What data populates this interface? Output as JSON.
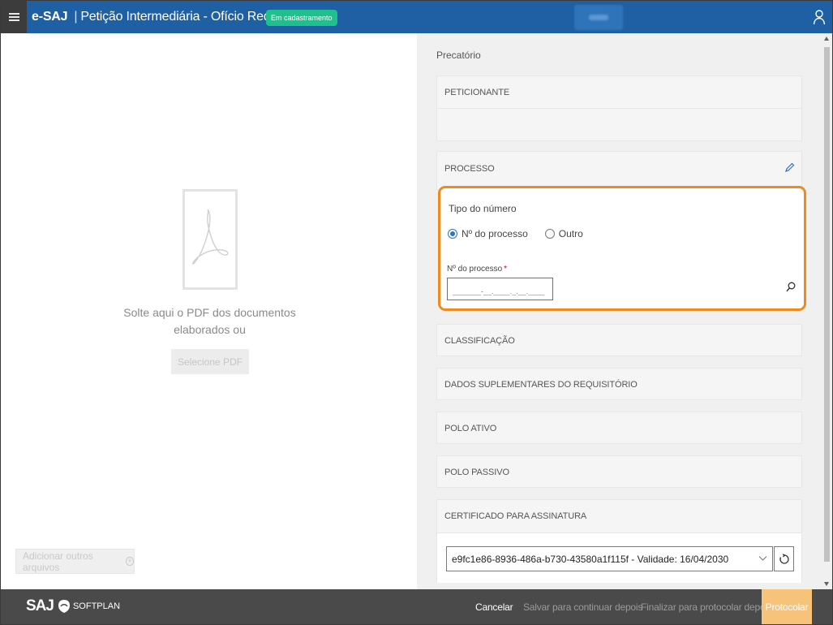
{
  "header": {
    "brand": "e-SAJ",
    "separator": "|",
    "title": "Petição Intermediária - Ofício Requisitório",
    "status_badge": "Em cadastramento"
  },
  "left": {
    "drop_text": "Solte aqui o PDF dos documentos elaborados ou",
    "select_pdf": "Selecione PDF",
    "add_files": "Adicionar outros arquivos",
    "add_files_icon": "plus-circle-icon"
  },
  "right": {
    "section": "Precatório",
    "peticionante": "PETICIONANTE",
    "processo": "PROCESSO",
    "tipo_label": "Tipo do número",
    "radio_processo": "Nº do processo",
    "radio_outro": "Outro",
    "numero_label": "Nº do processo",
    "required_mark": "*",
    "numero_placeholder": "_______-__.____._.__.____",
    "classificacao": "CLASSIFICAÇÃO",
    "dados": "DADOS SUPLEMENTARES DO REQUISITÓRIO",
    "polo_ativo": "POLO ATIVO",
    "polo_passivo": "POLO PASSIVO",
    "certificado": "CERTIFICADO PARA ASSINATURA",
    "certificado_value": "e9fc1e86-8936-486a-b730-43580a1f115f - Validade: 16/04/2030"
  },
  "footer": {
    "logo_saj": "SAJ",
    "logo_softplan": "SOFTPLAN",
    "cancel": "Cancelar",
    "salvar": "Salvar para continuar depois",
    "finalizar": "Finalizar para protocolar depois",
    "protocolar": "Protocolar"
  },
  "colors": {
    "header_bg": "#1f5fa3",
    "badge": "#1fbf8e",
    "highlight": "#f08a1e",
    "protocolar_bg": "#f7c27a",
    "footer_bg": "#4a4a4a"
  }
}
